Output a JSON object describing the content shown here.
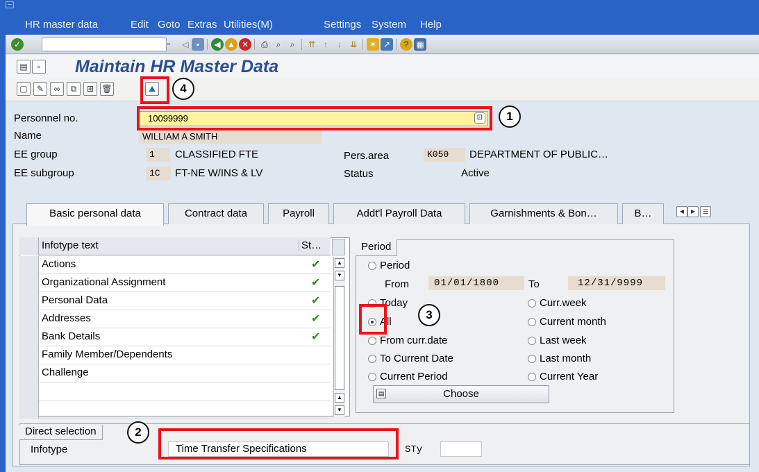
{
  "menu": [
    "HR master data",
    "Edit",
    "Goto",
    "Extras",
    "Utilities(M)",
    "Settings",
    "System",
    "Help"
  ],
  "page_title": "Maintain HR Master Data",
  "header": {
    "personnel_no_label": "Personnel no.",
    "personnel_no_value": "10099999",
    "name_label": "Name",
    "name_value": "WILLIAM A SMITH",
    "ee_group_label": "EE group",
    "ee_group_code": "1",
    "ee_group_text": "CLASSIFIED FTE",
    "ee_subgroup_label": "EE subgroup",
    "ee_subgroup_code": "1C",
    "ee_subgroup_text": "FT-NE W/INS & LV",
    "pers_area_label": "Pers.area",
    "pers_area_code": "K050",
    "pers_area_text": "DEPARTMENT OF PUBLIC…",
    "status_label": "Status",
    "status_value": "Active"
  },
  "tabs": [
    "Basic personal data",
    "Contract data",
    "Payroll",
    "Addt'l Payroll Data",
    "Garnishments & Bon…",
    "B…"
  ],
  "infotype_table": {
    "col_text": "Infotype text",
    "col_status": "St…",
    "rows": [
      {
        "text": "Actions",
        "status": "✔"
      },
      {
        "text": "Organizational Assignment",
        "status": "✔"
      },
      {
        "text": "Personal Data",
        "status": "✔"
      },
      {
        "text": "Addresses",
        "status": "✔"
      },
      {
        "text": "Bank Details",
        "status": "✔"
      },
      {
        "text": "Family Member/Dependents",
        "status": ""
      },
      {
        "text": "Challenge",
        "status": ""
      }
    ]
  },
  "period": {
    "title": "Period",
    "opt_period": "Period",
    "from_label": "From",
    "from_value": "01/01/1800",
    "to_label": "To",
    "to_value": "12/31/9999",
    "opt_today": "Today",
    "opt_curr_week": "Curr.week",
    "opt_all": "All",
    "opt_current_month": "Current month",
    "opt_from_curr_date": "From curr.date",
    "opt_last_week": "Last week",
    "opt_to_current_date": "To Current Date",
    "opt_last_month": "Last month",
    "opt_current_period": "Current Period",
    "opt_current_year": "Current Year",
    "selected": "All",
    "choose_label": "Choose"
  },
  "direct_selection": {
    "title": "Direct selection",
    "infotype_label": "Infotype",
    "infotype_value": "Time Transfer Specifications",
    "sty_label": "STy",
    "sty_value": ""
  },
  "callouts": [
    "1",
    "2",
    "3",
    "4"
  ],
  "colors": {
    "accent_red": "#e8141d",
    "title_blue": "#2b4e8f",
    "frame_blue": "#2a63c6"
  }
}
